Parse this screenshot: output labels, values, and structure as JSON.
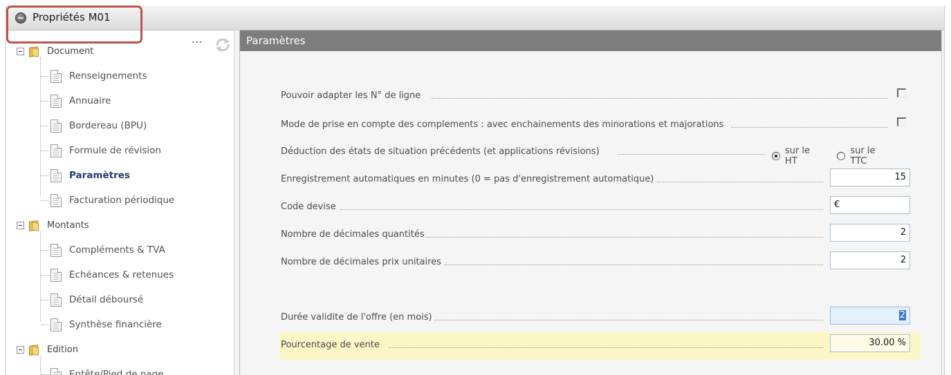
{
  "window": {
    "title": "Propriétés M01"
  },
  "toolbar": {
    "more_label": "..."
  },
  "tree": {
    "groups": [
      {
        "label": "Document",
        "items": [
          {
            "label": "Renseignements"
          },
          {
            "label": "Annuaire"
          },
          {
            "label": "Bordereau (BPU)"
          },
          {
            "label": "Formule de révision"
          },
          {
            "label": "Paramètres",
            "active": true
          },
          {
            "label": "Facturation périodique"
          }
        ]
      },
      {
        "label": "Montants",
        "items": [
          {
            "label": "Compléments & TVA"
          },
          {
            "label": "Echéances & retenues"
          },
          {
            "label": "Détail déboursé"
          },
          {
            "label": "Synthèse financière"
          }
        ]
      },
      {
        "label": "Edition",
        "items": [
          {
            "label": "Entête/Pied de page"
          }
        ]
      }
    ]
  },
  "params": {
    "header": "Paramètres",
    "rows": {
      "adapt_line_numbers": {
        "label": "Pouvoir adapter les N° de ligne",
        "checked": false
      },
      "complements_mode": {
        "label": "Mode de prise en compte des complements : avec enchainements des minorations et majorations",
        "checked": false
      },
      "deduction": {
        "label": "Déduction des états de situation précédents (et applications révisions)",
        "options": [
          "sur le HT",
          "sur le TTC"
        ],
        "selected": "sur le HT"
      },
      "autosave": {
        "label": "Enregistrement automatiques en minutes (0 = pas d'enregistrement automatique)",
        "value": "15"
      },
      "currency": {
        "label": "Code devise",
        "value": "€"
      },
      "qty_decimals": {
        "label": "Nombre de décimales quantités",
        "value": "2"
      },
      "price_decimals": {
        "label": "Nombre de décimales prix unitaires",
        "value": "2"
      },
      "offer_validity": {
        "label": "Durée validite de l'offre (en mois)",
        "value": "2"
      },
      "sale_percent": {
        "label": "Pourcentage de vente",
        "value": "30.00 %"
      }
    }
  },
  "colors": {
    "header_bg": "#7d7d7d",
    "active_item": "#1f3f73",
    "highlight_row": "#fbf7c7",
    "annotation_box": "#c0504d"
  }
}
